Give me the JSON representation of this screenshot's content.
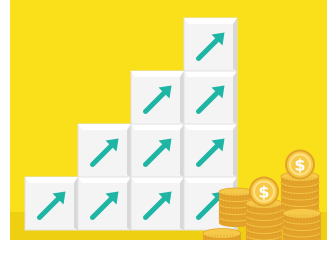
{
  "illustration": {
    "subject": "staircase-of-cubes-with-up-arrows-and-coin-stacks",
    "arrow_icon": "arrow-up-right-icon",
    "coin_symbol": "$",
    "colors": {
      "background": "#FADF1B",
      "floor": "#EFCF12",
      "cube_front": "#F4F4F4",
      "cube_top": "#FFFFFF",
      "cube_side": "#D8D8D8",
      "arrow": "#1FB5A4",
      "coin_face": "#F7C948",
      "coin_edge": "#E3A22A",
      "coin_rim": "#FDE28A"
    }
  },
  "steps": [
    {
      "column": 1,
      "cube_count": 1
    },
    {
      "column": 2,
      "cube_count": 2
    },
    {
      "column": 3,
      "cube_count": 3
    },
    {
      "column": 4,
      "cube_count": 4
    }
  ],
  "coin_stacks": [
    {
      "name": "back-left",
      "coins": 5,
      "labeled": false
    },
    {
      "name": "back-right",
      "coins": 8,
      "labeled": true
    },
    {
      "name": "middle",
      "coins": 6,
      "labeled": true
    },
    {
      "name": "front-right",
      "coins": 6,
      "labeled": false
    },
    {
      "name": "front-left",
      "coins": 2,
      "labeled": false
    }
  ]
}
